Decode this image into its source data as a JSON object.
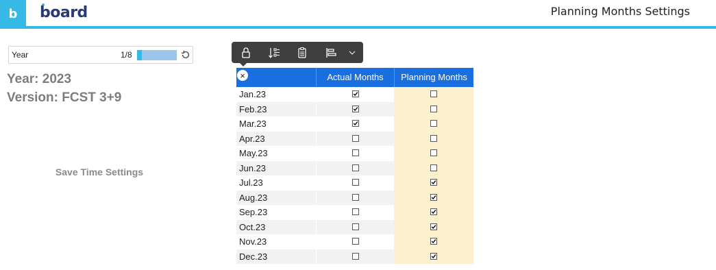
{
  "header": {
    "logo_letter": "b",
    "logo_text": "board",
    "title": "Planning Months Settings",
    "accent": "#35b9e6"
  },
  "selector": {
    "label": "Year",
    "count": "1/8",
    "progress": 0.125,
    "reset_icon": "reset-icon"
  },
  "info": {
    "year": "Year: 2023",
    "version": "Version: FCST 3+9"
  },
  "save_button": "Save Time Settings",
  "toolbar": {
    "icons": [
      "lock-icon",
      "sort-filter-icon",
      "clipboard-icon",
      "layout-icon",
      "chevron-down-icon"
    ]
  },
  "grid": {
    "close": "×",
    "headers": {
      "actual": "Actual Months",
      "planning": "Planning Months"
    },
    "header_color": "#1a6fe0",
    "planning_bg": "#fdf0ce",
    "rows": [
      {
        "month": "Jan.23",
        "actual": true,
        "planning": false
      },
      {
        "month": "Feb.23",
        "actual": true,
        "planning": false
      },
      {
        "month": "Mar.23",
        "actual": true,
        "planning": false
      },
      {
        "month": "Apr.23",
        "actual": false,
        "planning": false
      },
      {
        "month": "May.23",
        "actual": false,
        "planning": false
      },
      {
        "month": "Jun.23",
        "actual": false,
        "planning": false
      },
      {
        "month": "Jul.23",
        "actual": false,
        "planning": true
      },
      {
        "month": "Aug.23",
        "actual": false,
        "planning": true
      },
      {
        "month": "Sep.23",
        "actual": false,
        "planning": true
      },
      {
        "month": "Oct.23",
        "actual": false,
        "planning": true
      },
      {
        "month": "Nov.23",
        "actual": false,
        "planning": true
      },
      {
        "month": "Dec.23",
        "actual": false,
        "planning": true
      }
    ]
  }
}
